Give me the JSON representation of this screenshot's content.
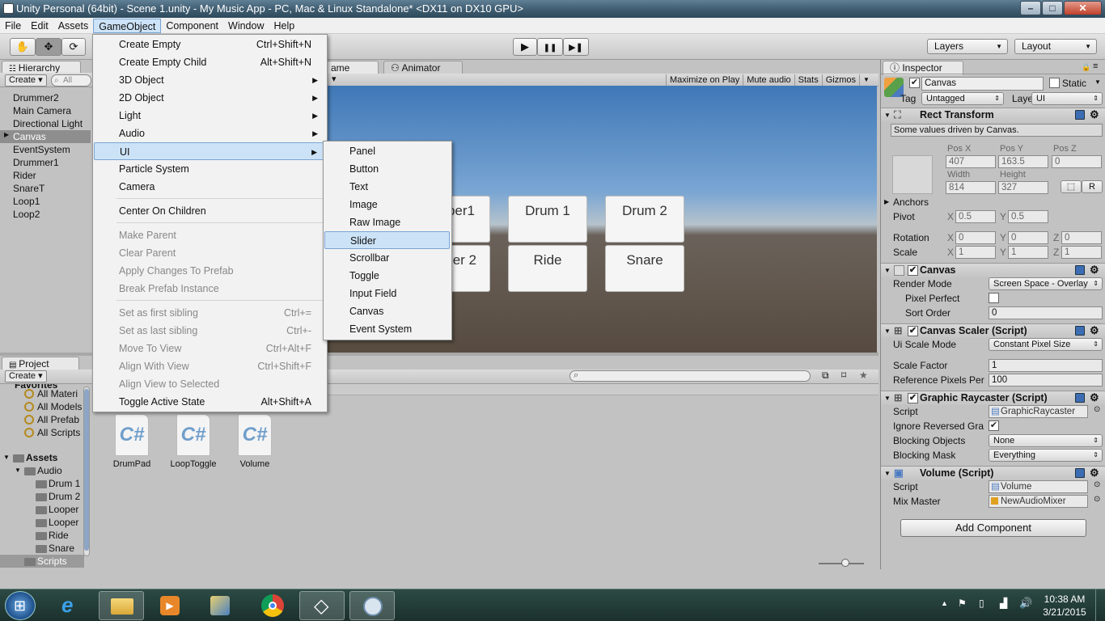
{
  "window": {
    "title": "Unity Personal (64bit) - Scene 1.unity - My Music App - PC, Mac & Linux Standalone* <DX11 on DX10 GPU>",
    "minimize": "–",
    "maximize": "□",
    "close": "✕"
  },
  "menubar": [
    "File",
    "Edit",
    "Assets",
    "GameObject",
    "Component",
    "Window",
    "Help"
  ],
  "toolbar": {
    "tools": [
      "hand-icon",
      "move-icon",
      "rotate-icon"
    ],
    "play": "▶",
    "pause": "❚❚",
    "step": "▶❚",
    "layers": "Layers",
    "layout": "Layout"
  },
  "hierarchy": {
    "tab": "Hierarchy",
    "create": "Create",
    "search_placeholder": "All",
    "items": [
      "Drummer2",
      "Main Camera",
      "Directional Light",
      "Canvas",
      "EventSystem",
      "Drummer1",
      "Rider",
      "SnareT",
      "Loop1",
      "Loop2"
    ]
  },
  "center_tabs": {
    "game": "ame",
    "animator": "Animator",
    "free_aspect": ""
  },
  "game_toolbar": [
    "Maximize on Play",
    "Mute audio",
    "Stats",
    "Gizmos"
  ],
  "game_buttons": [
    "per1",
    "Drum 1",
    "Drum 2",
    "per 2",
    "Ride",
    "Snare"
  ],
  "project": {
    "tab": "Project",
    "create": "Create",
    "favorites_header": "Favorites",
    "favorites": [
      "All Materi",
      "All Models",
      "All Prefab",
      "All Scripts"
    ],
    "assets_header": "Assets",
    "audio": "Audio",
    "audio_items": [
      "Drum 1",
      "Drum 2",
      "Looper",
      "Looper",
      "Ride",
      "Snare"
    ],
    "scripts": "Scripts",
    "files": [
      "DrumPad",
      "LoopToggle",
      "Volume"
    ],
    "file_icon_text": "C#"
  },
  "gameobject_menu": [
    {
      "label": "Create Empty",
      "shortcut": "Ctrl+Shift+N",
      "submenu": false,
      "disabled": false
    },
    {
      "label": "Create Empty Child",
      "shortcut": "Alt+Shift+N",
      "submenu": false,
      "disabled": false
    },
    {
      "label": "3D Object",
      "shortcut": "",
      "submenu": true,
      "disabled": false
    },
    {
      "label": "2D Object",
      "shortcut": "",
      "submenu": true,
      "disabled": false
    },
    {
      "label": "Light",
      "shortcut": "",
      "submenu": true,
      "disabled": false
    },
    {
      "label": "Audio",
      "shortcut": "",
      "submenu": true,
      "disabled": false
    },
    {
      "label": "UI",
      "shortcut": "",
      "submenu": true,
      "disabled": false
    },
    {
      "label": "Particle System",
      "shortcut": "",
      "submenu": false,
      "disabled": false
    },
    {
      "label": "Camera",
      "shortcut": "",
      "submenu": false,
      "disabled": false
    },
    {
      "label": "Center On Children",
      "shortcut": "",
      "submenu": false,
      "disabled": false
    },
    {
      "label": "Make Parent",
      "shortcut": "",
      "submenu": false,
      "disabled": true
    },
    {
      "label": "Clear Parent",
      "shortcut": "",
      "submenu": false,
      "disabled": true
    },
    {
      "label": "Apply Changes To Prefab",
      "shortcut": "",
      "submenu": false,
      "disabled": true
    },
    {
      "label": "Break Prefab Instance",
      "shortcut": "",
      "submenu": false,
      "disabled": true
    },
    {
      "label": "Set as first sibling",
      "shortcut": "Ctrl+=",
      "submenu": false,
      "disabled": true
    },
    {
      "label": "Set as last sibling",
      "shortcut": "Ctrl+-",
      "submenu": false,
      "disabled": true
    },
    {
      "label": "Move To View",
      "shortcut": "Ctrl+Alt+F",
      "submenu": false,
      "disabled": true
    },
    {
      "label": "Align With View",
      "shortcut": "Ctrl+Shift+F",
      "submenu": false,
      "disabled": true
    },
    {
      "label": "Align View to Selected",
      "shortcut": "",
      "submenu": false,
      "disabled": true
    },
    {
      "label": "Toggle Active State",
      "shortcut": "Alt+Shift+A",
      "submenu": false,
      "disabled": false
    }
  ],
  "ui_submenu": [
    "Panel",
    "Button",
    "Text",
    "Image",
    "Raw Image",
    "Slider",
    "Scrollbar",
    "Toggle",
    "Input Field",
    "Canvas",
    "Event System"
  ],
  "inspector": {
    "tab": "Inspector",
    "object_name": "Canvas",
    "static_label": "Static",
    "tag_label": "Tag",
    "tag_value": "Untagged",
    "layer_label": "Layer",
    "layer_value": "UI",
    "rect_transform": {
      "title": "Rect Transform",
      "note": "Some values driven by Canvas.",
      "pos_x_label": "Pos X",
      "pos_y_label": "Pos Y",
      "pos_z_label": "Pos Z",
      "pos_x": "407",
      "pos_y": "163.5",
      "pos_z": "0",
      "width_label": "Width",
      "height_label": "Height",
      "width": "814",
      "height": "327",
      "r_button": "R",
      "anchors": "Anchors",
      "pivot_label": "Pivot",
      "pivot_x": "0.5",
      "pivot_y": "0.5",
      "rotation_label": "Rotation",
      "rot_x": "0",
      "rot_y": "0",
      "rot_z": "0",
      "scale_label": "Scale",
      "scale_x": "1",
      "scale_y": "1",
      "scale_z": "1",
      "x": "X",
      "y": "Y",
      "z": "Z"
    },
    "canvas": {
      "title": "Canvas",
      "render_mode_label": "Render Mode",
      "render_mode": "Screen Space - Overlay",
      "pixel_perfect_label": "Pixel Perfect",
      "sort_order_label": "Sort Order",
      "sort_order": "0"
    },
    "canvas_scaler": {
      "title": "Canvas Scaler (Script)",
      "ui_scale_mode_label": "Ui Scale Mode",
      "ui_scale_mode": "Constant Pixel Size",
      "scale_factor_label": "Scale Factor",
      "scale_factor": "1",
      "ref_pixels_label": "Reference Pixels Per",
      "ref_pixels": "100"
    },
    "graphic_raycaster": {
      "title": "Graphic Raycaster (Script)",
      "script_label": "Script",
      "script": "GraphicRaycaster",
      "ignore_label": "Ignore Reversed Gra",
      "blocking_objects_label": "Blocking Objects",
      "blocking_objects": "None",
      "blocking_mask_label": "Blocking Mask",
      "blocking_mask": "Everything"
    },
    "volume": {
      "title": "Volume (Script)",
      "script_label": "Script",
      "script": "Volume",
      "mix_master_label": "Mix Master",
      "mix_master": "NewAudioMixer"
    },
    "add_component": "Add Component"
  },
  "taskbar": {
    "time": "10:38 AM",
    "date": "3/21/2015",
    "apps": [
      "ie-icon",
      "explorer-icon",
      "media-player-icon",
      "paint-icon",
      "chrome-icon",
      "unity-icon",
      "remote-icon"
    ]
  }
}
